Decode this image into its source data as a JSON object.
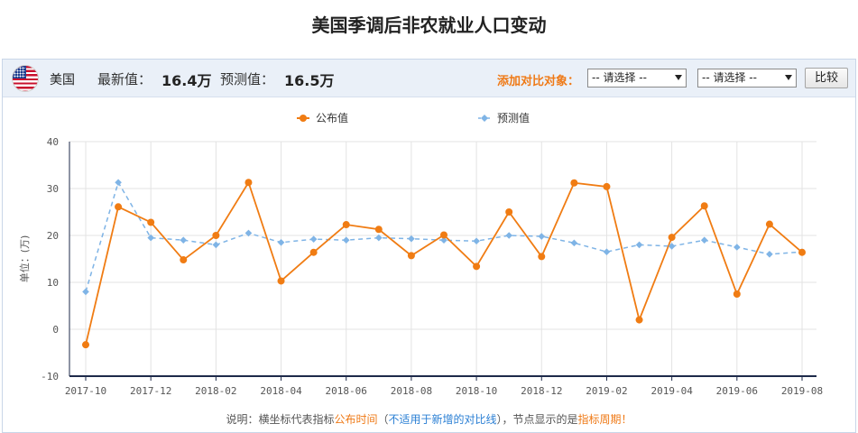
{
  "page": {
    "title": "美国季调后非农就业人口变动"
  },
  "toolbar": {
    "country": "美国",
    "latest_label": "最新值：",
    "latest_value": "16.4万",
    "forecast_label": "预测值：",
    "forecast_value": "16.5万",
    "compare_label": "添加对比对象：",
    "select1_value": "-- 请选择 --",
    "select2_value": "-- 请选择 --",
    "compare_button": "比较"
  },
  "note": {
    "prefix": "说明：横坐标代表指标",
    "publish_time": "公布时间",
    "paren_open": "（",
    "not_applicable": "不适用于新增的对比线",
    "paren_close": "）",
    "middle": "，节点显示的是",
    "period": "指标周期",
    "suffix": "！"
  },
  "colors": {
    "published": "#f07c13",
    "forecast": "#7fb4e6",
    "grid": "#e3e3e3",
    "axis": "#1e2a4a"
  },
  "icons": {
    "flag": "us-flag-icon"
  },
  "chart_data": {
    "type": "line",
    "ylabel": "单位：(万)",
    "ylim": [
      -10,
      40
    ],
    "yticks": [
      -10,
      0,
      10,
      20,
      30,
      40
    ],
    "xtick_labels": [
      "2017-10",
      "2017-12",
      "2018-02",
      "2018-04",
      "2018-06",
      "2018-08",
      "2018-10",
      "2018-12",
      "2019-02",
      "2019-04",
      "2019-06",
      "2019-08"
    ],
    "x": [
      "2017-10",
      "2017-11",
      "2017-12",
      "2018-01",
      "2018-02",
      "2018-03",
      "2018-04",
      "2018-05",
      "2018-06",
      "2018-07",
      "2018-08",
      "2018-09",
      "2018-10",
      "2018-11",
      "2018-12",
      "2019-01",
      "2019-02",
      "2019-03",
      "2019-04",
      "2019-05",
      "2019-06",
      "2019-07",
      "2019-08"
    ],
    "grid": true,
    "legend_position": "top-center",
    "series": [
      {
        "name": "公布值",
        "style": "solid",
        "marker": "circle",
        "values": [
          -3.3,
          26.1,
          22.8,
          14.8,
          20.0,
          31.3,
          10.3,
          16.4,
          22.3,
          21.3,
          15.7,
          20.1,
          13.4,
          25.0,
          15.5,
          31.2,
          30.4,
          2.0,
          19.6,
          26.3,
          7.5,
          22.4,
          16.4
        ]
      },
      {
        "name": "预测值",
        "style": "dashed",
        "marker": "diamond",
        "values": [
          8.0,
          31.3,
          19.5,
          19.0,
          18.0,
          20.5,
          18.5,
          19.2,
          19.0,
          19.5,
          19.3,
          19.0,
          18.8,
          20.0,
          19.8,
          18.4,
          16.5,
          18.0,
          17.7,
          19.0,
          17.5,
          16.0,
          16.5
        ]
      }
    ]
  }
}
